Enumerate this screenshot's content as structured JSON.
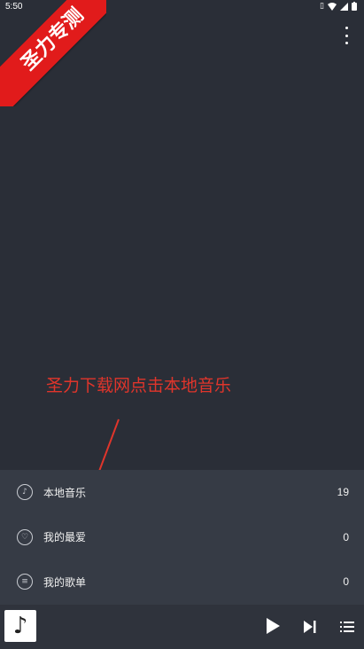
{
  "status_bar": {
    "time": "5:50"
  },
  "ribbon": {
    "text": "圣力专测"
  },
  "annotation": {
    "text": "圣力下载网点击本地音乐"
  },
  "menu": {
    "items": [
      {
        "label": "本地音乐",
        "count": "19",
        "icon": "music-disc-icon"
      },
      {
        "label": "我的最爱",
        "count": "0",
        "icon": "heart-icon"
      },
      {
        "label": "我的歌单",
        "count": "0",
        "icon": "playlist-icon"
      }
    ]
  },
  "player": {
    "album_art_icon": "music-note-icon"
  },
  "colors": {
    "background": "#2a2e37",
    "list_background": "#363b45",
    "ribbon": "#e11b1b",
    "annotation": "#e0352b"
  }
}
